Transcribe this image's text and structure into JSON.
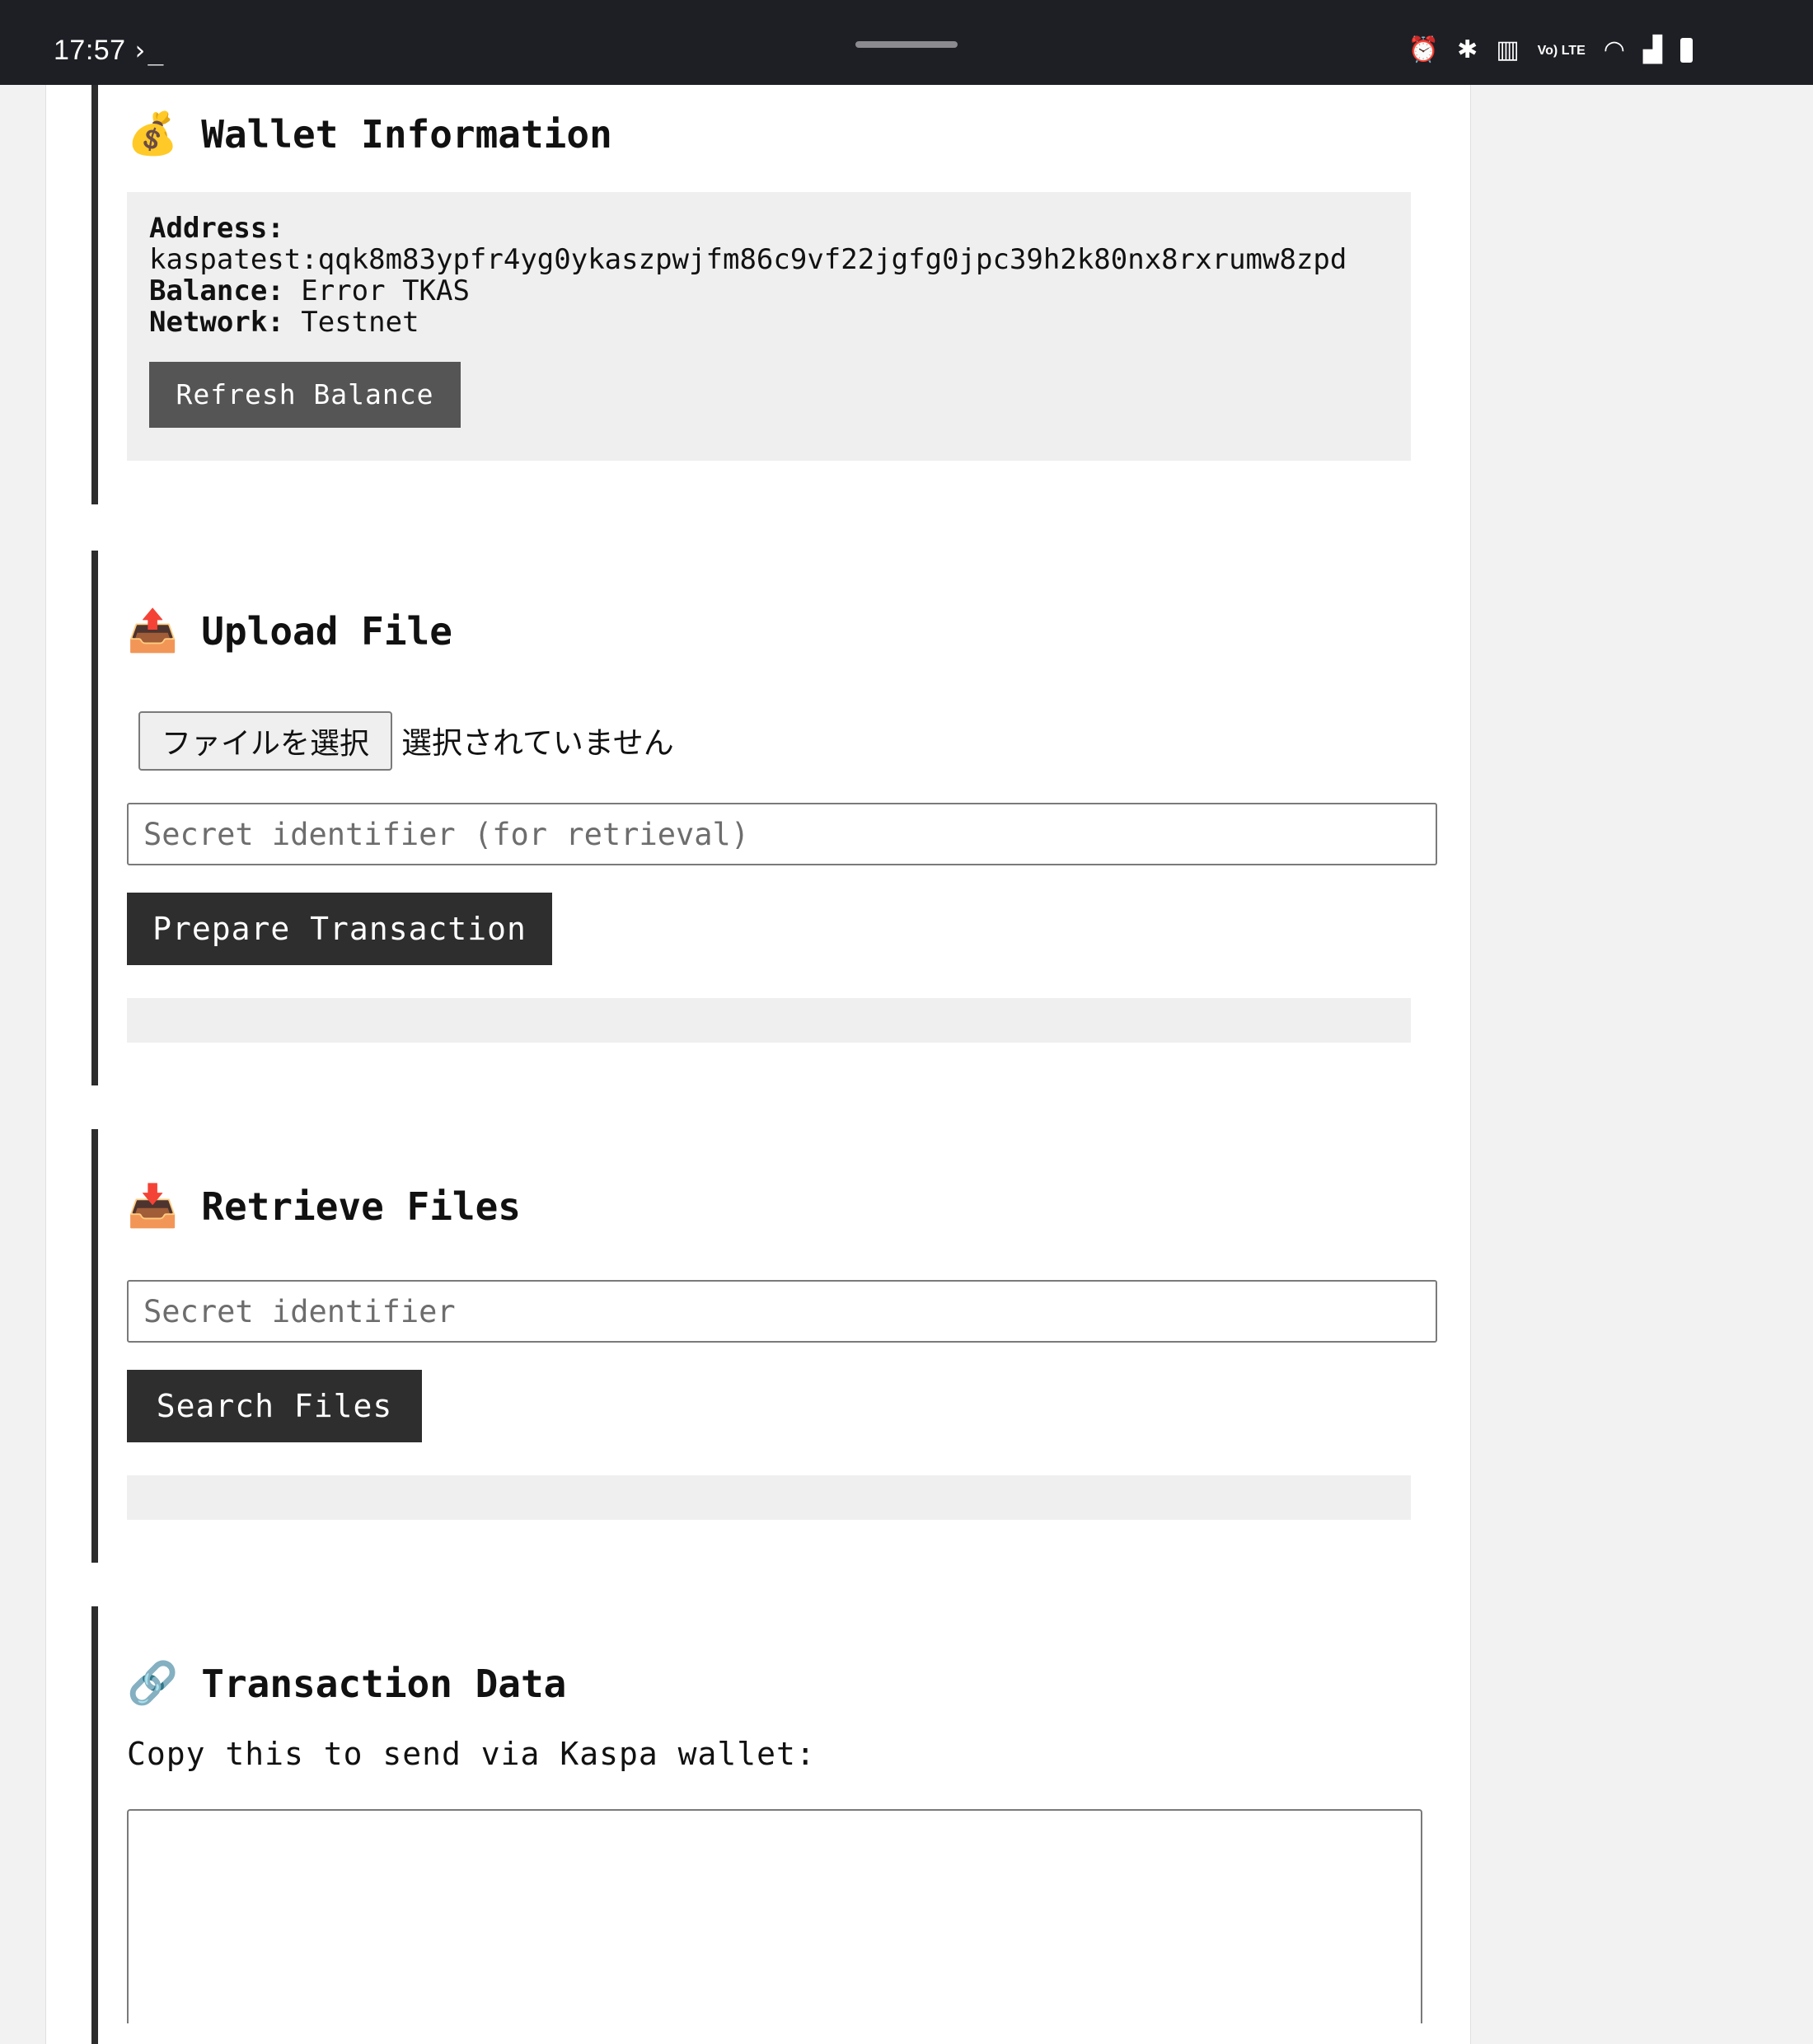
{
  "status_bar": {
    "time": "17:57",
    "terminal_glyph": "›_",
    "icons": [
      "alarm-icon",
      "bluetooth-icon",
      "vibrate-icon",
      "volte-icon",
      "wifi-icon",
      "signal-icon",
      "battery-icon"
    ],
    "volte_label": "Vo) LTE"
  },
  "wallet": {
    "title": "Wallet Information",
    "emoji": "💰",
    "address_label": "Address:",
    "address_value": "kaspatest:qqk8m83ypfr4yg0ykaszpwjfm86c9vf22jgfg0jpc39h2k80nx8rxrumw8zpd",
    "balance_label": "Balance:",
    "balance_value": "Error TKAS",
    "network_label": "Network:",
    "network_value": "Testnet",
    "refresh_button": "Refresh Balance"
  },
  "upload": {
    "title": "Upload File",
    "emoji": "📤",
    "choose_file_button": "ファイルを選択",
    "no_file_text": "選択されていません",
    "secret_placeholder": "Secret identifier (for retrieval)",
    "prepare_button": "Prepare Transaction"
  },
  "retrieve": {
    "title": "Retrieve Files",
    "emoji": "📥",
    "secret_placeholder": "Secret identifier",
    "search_button": "Search Files"
  },
  "transaction": {
    "title": "Transaction Data",
    "emoji": "🔗",
    "instruction": "Copy this to send via Kaspa wallet:",
    "data_value": ""
  },
  "colors": {
    "status_bar_bg": "#1e1f24",
    "page_bg": "#f2f2f2",
    "card_bg": "#ffffff",
    "section_border": "#2d2d2d",
    "box_bg": "#efefef",
    "button_dark": "#2e2e2e",
    "button_gray": "#555555"
  }
}
